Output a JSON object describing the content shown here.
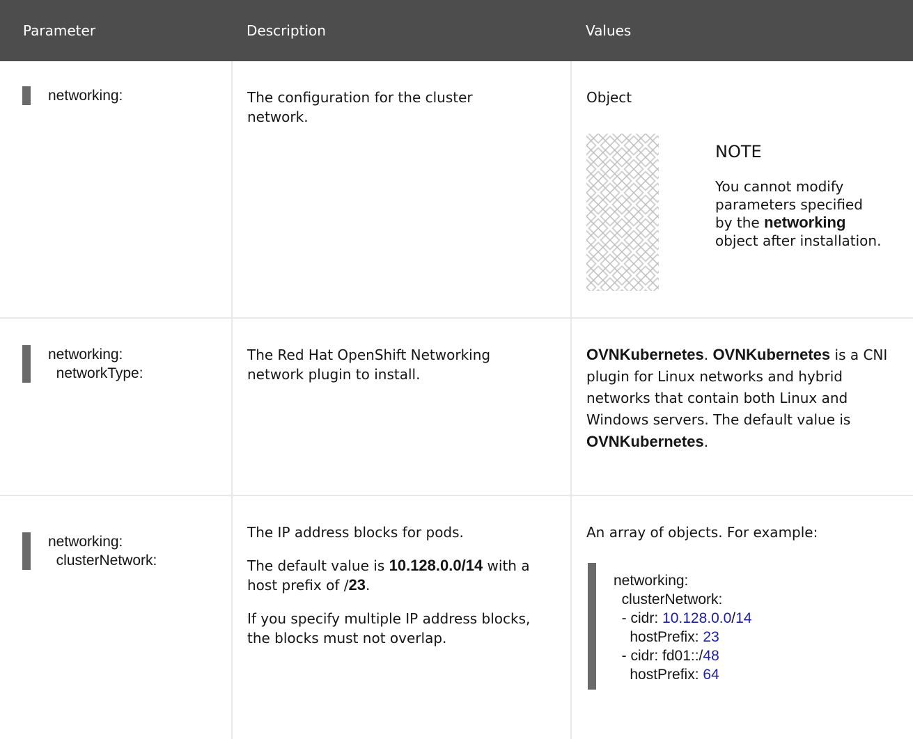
{
  "table": {
    "headers": [
      "Parameter",
      "Description",
      "Values"
    ],
    "rows": [
      {
        "param_lines": [
          "networking:"
        ],
        "description": [
          "The configuration for the cluster network."
        ],
        "value": "Object",
        "note": {
          "title": "NOTE",
          "text_before": "You cannot modify parameters specified by the ",
          "text_bold": "networking",
          "text_after": " object after installation."
        }
      },
      {
        "param_lines": [
          "networking:",
          "  networkType:"
        ],
        "description": [
          "The Red Hat OpenShift Networking network plugin to install."
        ],
        "value_parts": {
          "bold1": "OVNKubernetes",
          "sep": ". ",
          "bold2": "OVNKubernetes",
          "text": " is a CNI plugin for Linux networks and hybrid networks that contain both Linux and Windows servers. The default value is ",
          "bold3": "OVNKubernetes",
          "end": "."
        }
      },
      {
        "param_lines": [
          "networking:",
          "  clusterNetwork:"
        ],
        "description": {
          "p1": "The IP address blocks for pods.",
          "p2_before": "The default value is ",
          "p2_bold1": "10.128.0.0/14",
          "p2_mid": " with a host prefix of /",
          "p2_bold2": "23",
          "p2_end": ".",
          "p3": "If you specify multiple IP address blocks, the blocks must not overlap."
        },
        "value_intro": "An array of objects. For example:",
        "example": {
          "line1": "networking:",
          "line2": "  clusterNetwork:",
          "cidr1_key": "  - cidr: ",
          "cidr1_a": "10.128.0.0",
          "cidr1_sep": "/",
          "cidr1_b": "14",
          "hp1_key": "    hostPrefix: ",
          "hp1_val": "23",
          "cidr2_key": "  - cidr: fd01::/",
          "cidr2_val": "48",
          "hp2_key": "    hostPrefix: ",
          "hp2_val": "64"
        }
      }
    ]
  },
  "colors": {
    "header_bg": "#4d4d4d",
    "border": "#e8e8e8",
    "code_bar": "#6a6a6a",
    "code_value": "#1d1dae"
  },
  "icons": [
    "note-pattern-icon"
  ]
}
